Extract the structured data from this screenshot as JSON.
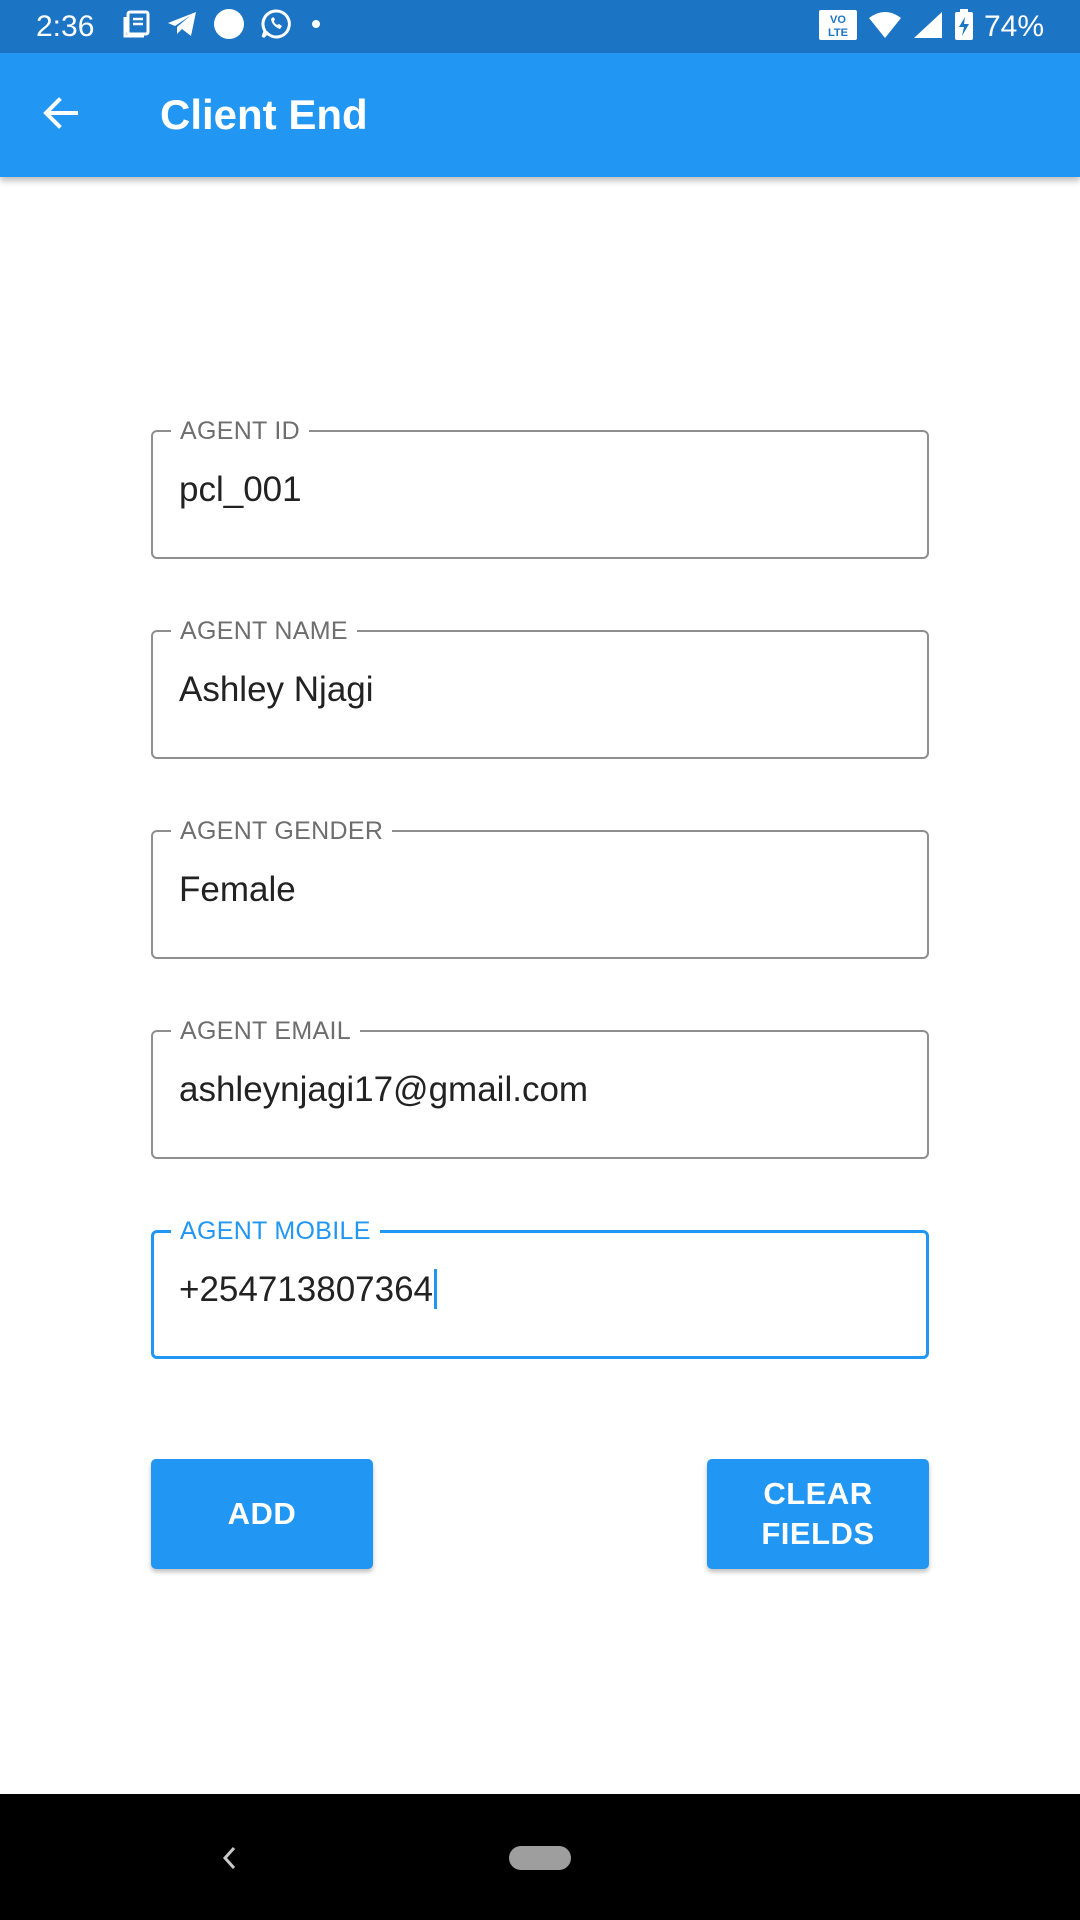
{
  "status_bar": {
    "time": "2:36",
    "battery": "74%",
    "volte": "VO\nLTE",
    "icons": [
      "news-icon",
      "telegram-icon",
      "circle-notification-icon",
      "whatsapp-icon",
      "more-notifications-dot-icon",
      "volte-icon",
      "wifi-icon",
      "cell-signal-icon",
      "battery-charging-icon"
    ]
  },
  "app_bar": {
    "title": "Client End",
    "back_icon": "arrow-back-icon"
  },
  "form": {
    "agent_id": {
      "label": "AGENT ID",
      "value": "pcl_001"
    },
    "agent_name": {
      "label": "AGENT NAME",
      "value": "Ashley Njagi"
    },
    "agent_gender": {
      "label": "AGENT GENDER",
      "value": "Female"
    },
    "agent_email": {
      "label": "AGENT EMAIL",
      "value": "ashleynjagi17@gmail.com"
    },
    "agent_mobile": {
      "label": "AGENT MOBILE",
      "value": "+254713807364"
    }
  },
  "buttons": {
    "add": "ADD",
    "clear_line1": "CLEAR",
    "clear_line2": "FIELDS"
  },
  "colors": {
    "status_bar": "#1c74c4",
    "app_bar": "#2196f3",
    "accent": "#2196f3",
    "nav_bar": "#000000"
  }
}
